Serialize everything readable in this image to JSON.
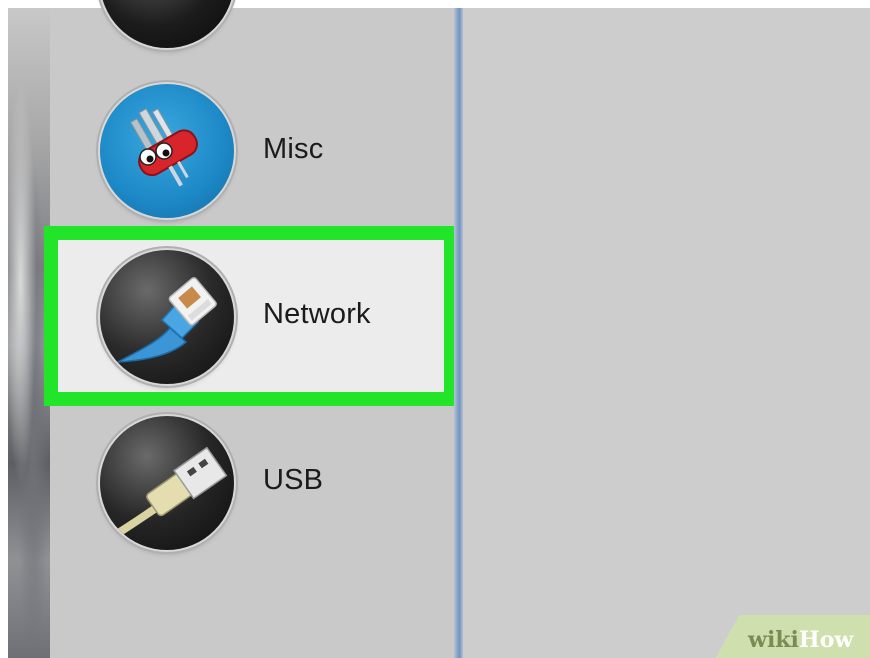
{
  "sidebar": {
    "items": [
      {
        "label": "",
        "icon": "dark-circle-icon"
      },
      {
        "label": "Misc",
        "icon": "swiss-army-knife-icon"
      },
      {
        "label": "Network",
        "icon": "ethernet-cable-icon",
        "selected": true
      },
      {
        "label": "USB",
        "icon": "usb-plug-icon"
      }
    ]
  },
  "watermark": {
    "wiki": "wiki",
    "how": "How"
  },
  "colors": {
    "highlight": "#22e52a",
    "sidebar_bg": "#c9c9c9",
    "selected_bg": "#ececec",
    "divider": "#6f93c2"
  }
}
